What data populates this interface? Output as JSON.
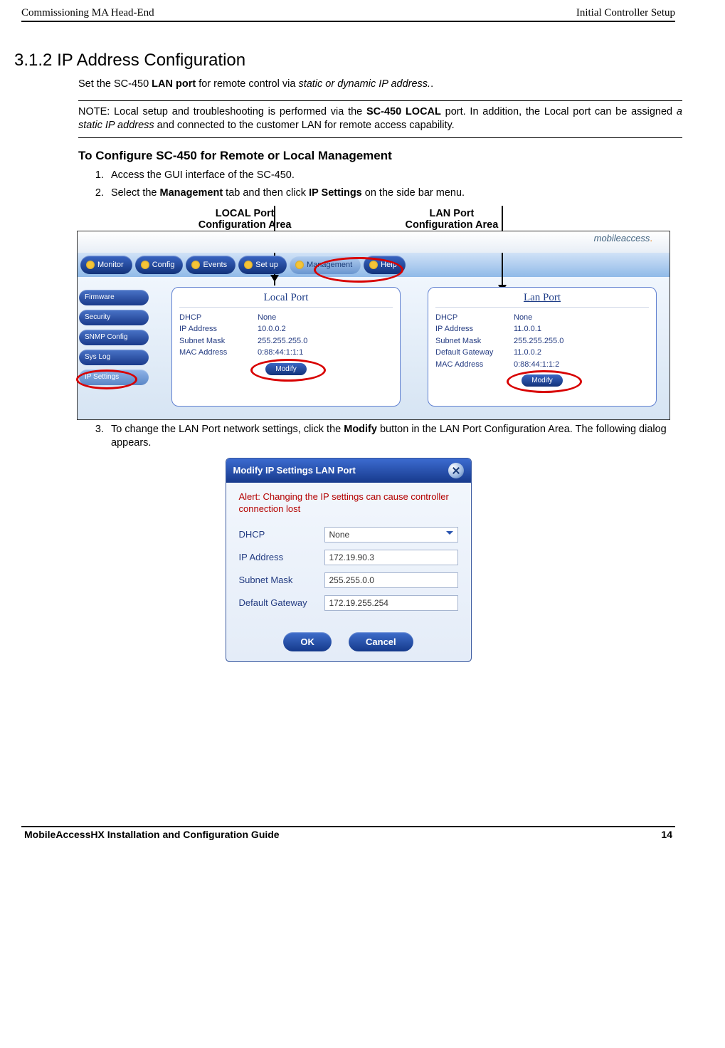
{
  "header": {
    "left": "Commissioning MA Head-End",
    "right": "Initial Controller Setup"
  },
  "section": {
    "number": "3.1.2",
    "title": "IP Address Configuration",
    "intro_pre": "Set the SC-450 ",
    "intro_bold": "LAN port",
    "intro_mid": " for remote control via ",
    "intro_em": "static or dynamic IP address.",
    "intro_post": "."
  },
  "note": {
    "pre": "NOTE: Local setup and troubleshooting is performed via the ",
    "bold1": "SC-450 LOCAL",
    "mid1": " port. In addition, the Local port can be assigned ",
    "em": "a static IP address",
    "post": " and connected to the customer LAN for remote access capability."
  },
  "config_heading": "To Configure SC-450 for Remote or Local Management",
  "steps": {
    "s1": "Access the GUI interface of the SC-450.",
    "s2_pre": "Select the ",
    "s2_b1": "Management",
    "s2_mid": " tab and then click ",
    "s2_b2": "IP Settings",
    "s2_post": " on the side bar menu.",
    "s3_pre": "To change the LAN Port network settings, click the ",
    "s3_b": "Modify",
    "s3_post": " button in the LAN Port Configuration Area. The following dialog appears."
  },
  "annotations": {
    "local_l1": "LOCAL Port",
    "local_l2": "Configuration Area",
    "lan_l1": "LAN Port",
    "lan_l2": "Configuration Area"
  },
  "screenshot1": {
    "logo": "mobileaccess",
    "nav": {
      "monitor": "Monitor",
      "config": "Config",
      "events": "Events",
      "setup": "Set up",
      "management": "Management",
      "help": "Help"
    },
    "sidebar": {
      "firmware": "Firmware",
      "security": "Security",
      "snmp": "SNMP Config",
      "syslog": "Sys Log",
      "ipsettings": "IP Settings"
    },
    "local": {
      "title": "Local Port",
      "dhcp_l": "DHCP",
      "dhcp_v": "None",
      "ip_l": "IP Address",
      "ip_v": "10.0.0.2",
      "sm_l": "Subnet Mask",
      "sm_v": "255.255.255.0",
      "mac_l": "MAC Address",
      "mac_v": "0:88:44:1:1:1",
      "modify": "Modify"
    },
    "lan": {
      "title": "Lan Port",
      "dhcp_l": "DHCP",
      "dhcp_v": "None",
      "ip_l": "IP Address",
      "ip_v": "11.0.0.1",
      "sm_l": "Subnet Mask",
      "sm_v": "255.255.255.0",
      "gw_l": "Default Gateway",
      "gw_v": "11.0.0.2",
      "mac_l": "MAC Address",
      "mac_v": "0:88:44:1:1:2",
      "modify": "Modify"
    }
  },
  "screenshot2": {
    "title": "Modify IP Settings LAN Port",
    "alert": "Alert: Changing the IP settings can cause controller connection lost",
    "dhcp_l": "DHCP",
    "dhcp_v": "None",
    "ip_l": "IP Address",
    "ip_v": "172.19.90.3",
    "sm_l": "Subnet Mask",
    "sm_v": "255.255.0.0",
    "gw_l": "Default Gateway",
    "gw_v": "172.19.255.254",
    "ok": "OK",
    "cancel": "Cancel"
  },
  "footer": {
    "left": "MobileAccessHX Installation and Configuration Guide",
    "right": "14"
  }
}
